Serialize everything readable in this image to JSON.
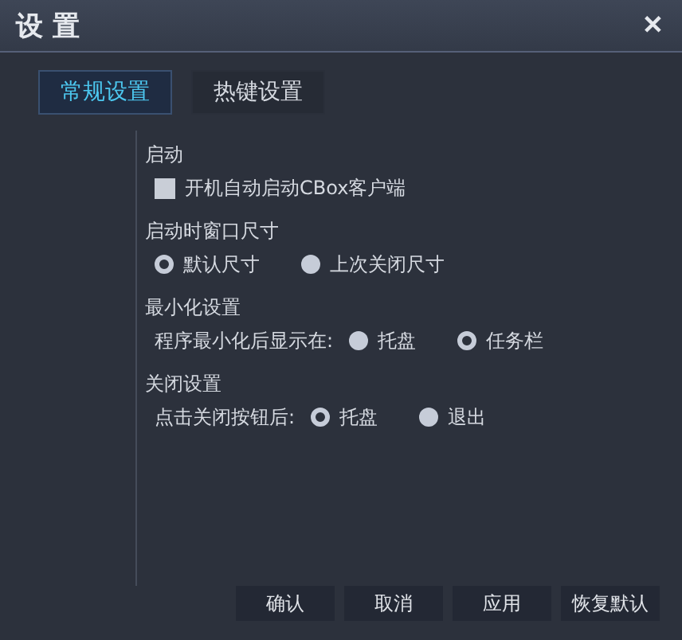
{
  "window": {
    "title": "设 置",
    "close": "✕"
  },
  "tabs": [
    {
      "label": "常规设置",
      "selected": true
    },
    {
      "label": "热键设置",
      "selected": false
    }
  ],
  "sections": [
    {
      "heading": "启动",
      "kind": "checkbox",
      "label": "开机自动启动CBox客户端",
      "checked": false
    },
    {
      "heading": "启动时窗口尺寸",
      "kind": "radio",
      "options": [
        {
          "label": "默认尺寸",
          "selected": true
        },
        {
          "label": "上次关闭尺寸",
          "selected": false
        }
      ]
    },
    {
      "heading": "最小化设置",
      "kind": "radio",
      "prompt": "程序最小化后显示在:",
      "options": [
        {
          "label": "托盘",
          "selected": false
        },
        {
          "label": "任务栏",
          "selected": true
        }
      ]
    },
    {
      "heading": "关闭设置",
      "kind": "radio",
      "prompt": "点击关闭按钮后:",
      "options": [
        {
          "label": "托盘",
          "selected": true
        },
        {
          "label": "退出",
          "selected": false
        }
      ]
    }
  ],
  "buttons": [
    "确认",
    "取消",
    "应用",
    "恢复默认"
  ]
}
